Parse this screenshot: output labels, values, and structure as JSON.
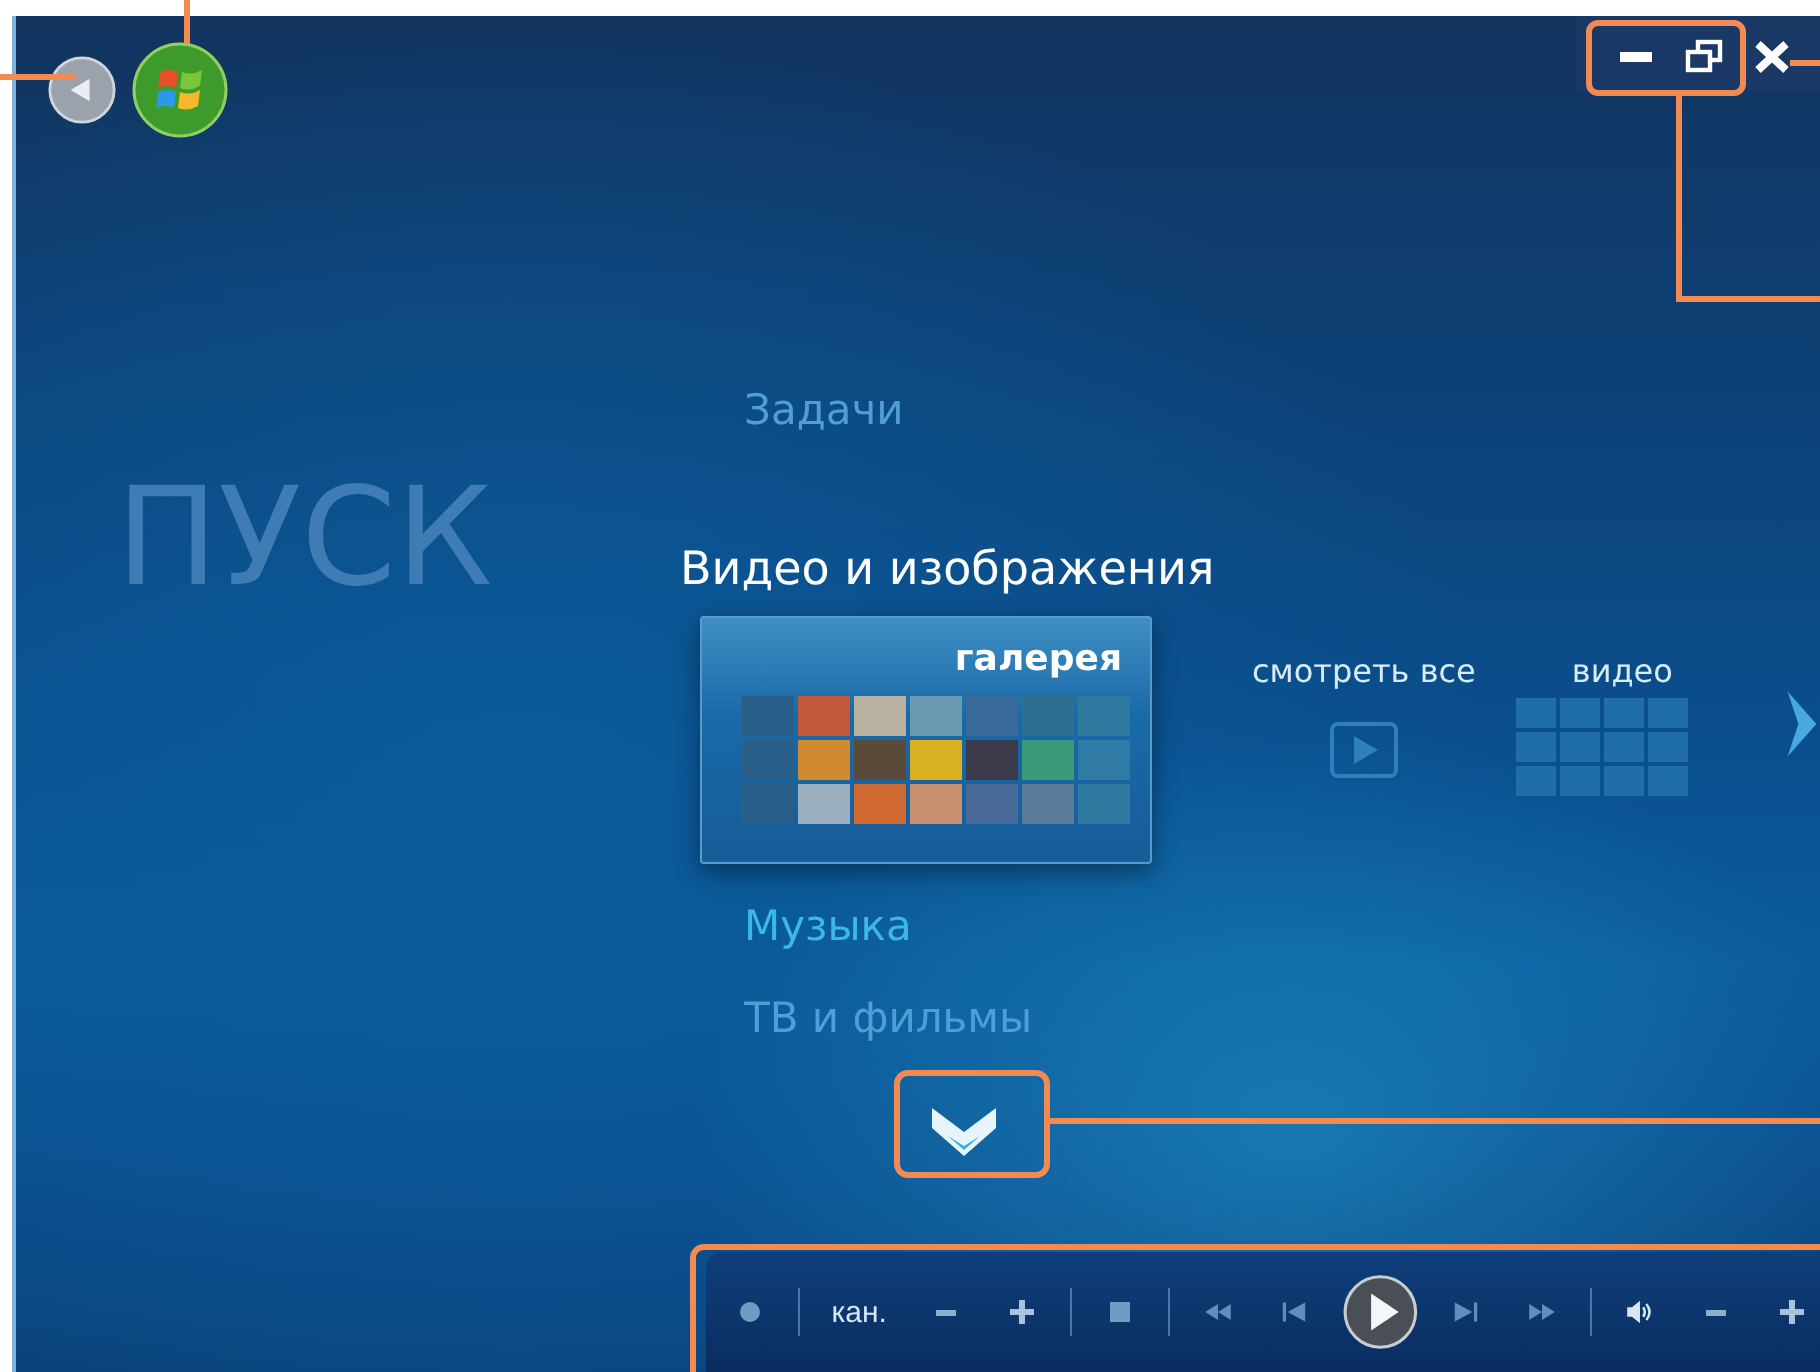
{
  "page_title": "ПУСК",
  "menu": [
    {
      "label": "Задачи",
      "selected": false,
      "dimmed": true
    },
    {
      "label": "Видео и изображения",
      "selected": true,
      "dimmed": false
    },
    {
      "label": "Музыка",
      "selected": false,
      "dimmed": false
    },
    {
      "label": "ТВ и фильмы",
      "selected": false,
      "dimmed": true
    }
  ],
  "tiles": [
    {
      "kind": "gallery",
      "label": "галерея",
      "selected": true
    },
    {
      "kind": "play",
      "label": "смотреть все",
      "selected": false
    },
    {
      "kind": "grid",
      "label": "видео",
      "selected": false
    }
  ],
  "transport": [
    {
      "kind": "record"
    },
    {
      "kind": "sep"
    },
    {
      "kind": "label",
      "text": "кан."
    },
    {
      "kind": "minus"
    },
    {
      "kind": "plus"
    },
    {
      "kind": "sep"
    },
    {
      "kind": "stop"
    },
    {
      "kind": "sep"
    },
    {
      "kind": "rewind"
    },
    {
      "kind": "prev"
    },
    {
      "kind": "play"
    },
    {
      "kind": "next"
    },
    {
      "kind": "forward"
    },
    {
      "kind": "sep"
    },
    {
      "kind": "volume"
    },
    {
      "kind": "minus"
    },
    {
      "kind": "plus"
    }
  ]
}
